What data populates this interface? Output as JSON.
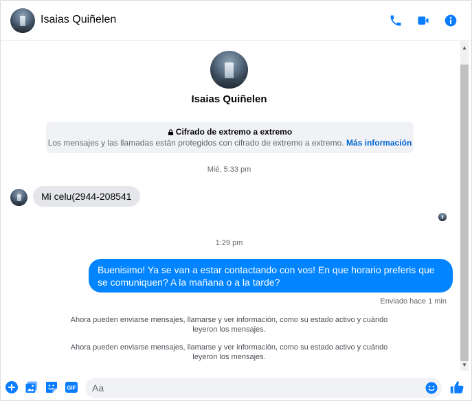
{
  "header": {
    "contact_name": "Isaias Quiñelen",
    "icons": [
      "phone-icon",
      "video-call-icon",
      "info-icon"
    ]
  },
  "profile": {
    "name": "Isaias Quiñelen"
  },
  "encryption": {
    "title": "Cifrado de extremo a extremo",
    "body": "Los mensajes y las llamadas están protegidos con cifrado de extremo a extremo.",
    "link": "Más información"
  },
  "messages": {
    "timestamp_1": "Mié, 5:33 pm",
    "incoming_text": "Mi celu(2944-208541",
    "timestamp_2": "1:29 pm",
    "outgoing_text": "Buenisimo! Ya se van a estar contactando con vos! En que horario preferis que se comuniquen? A la mañana o a la tarde?",
    "sent_status": "Enviado hace 1 min",
    "notice_1": "Ahora pueden enviarse mensajes, llamarse y ver información, como su estado activo y cuándo leyeron los mensajes.",
    "notice_2": "Ahora pueden enviarse mensajes, llamarse y ver información, como su estado activo y cuándo leyeron los mensajes."
  },
  "composer": {
    "placeholder": "Aa",
    "gif_label": "GIF",
    "icons": [
      "plus-icon",
      "photo-icon",
      "sticker-icon",
      "gif-icon",
      "emoji-icon",
      "thumbs-up-icon"
    ]
  },
  "colors": {
    "accent": "#0084ff",
    "icon_blue": "#0a7cff",
    "incoming_bubble": "#e4e6eb",
    "muted_text": "#65676b"
  }
}
